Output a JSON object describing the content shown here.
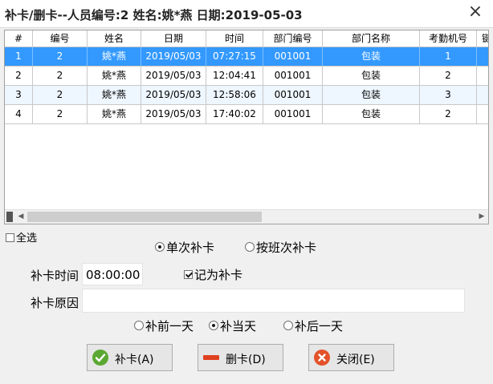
{
  "window": {
    "title": "补卡/删卡--人员编号:2 姓名:姚*燕 日期:2019-05-03",
    "close_glyph": "×"
  },
  "table": {
    "columns": [
      "#",
      "编号",
      "姓名",
      "日期",
      "时间",
      "部门编号",
      "部门名称",
      "考勤机号",
      "键"
    ],
    "rows": [
      [
        "1",
        "2",
        "姚*燕",
        "2019/05/03",
        "07:27:15",
        "001001",
        "包装",
        "1"
      ],
      [
        "2",
        "2",
        "姚*燕",
        "2019/05/03",
        "12:04:41",
        "001001",
        "包装",
        "2"
      ],
      [
        "3",
        "2",
        "姚*燕",
        "2019/05/03",
        "12:58:06",
        "001001",
        "包装",
        "3"
      ],
      [
        "4",
        "2",
        "姚*燕",
        "2019/05/03",
        "17:40:02",
        "001001",
        "包装",
        "2"
      ]
    ],
    "selected_row": 0
  },
  "select_all": {
    "label": "全选",
    "checked": false
  },
  "mode": {
    "single": {
      "label": "单次补卡",
      "checked": true
    },
    "by_shift": {
      "label": "按班次补卡",
      "checked": false
    }
  },
  "form": {
    "time_label": "补卡时间",
    "time_value": "08:00:00",
    "record_as": {
      "label": "记为补卡",
      "checked": true
    },
    "reason_label": "补卡原因",
    "reason_value": ""
  },
  "day": {
    "prev": {
      "label": "补前一天",
      "checked": false
    },
    "current": {
      "label": "补当天",
      "checked": true
    },
    "next": {
      "label": "补后一天",
      "checked": false
    }
  },
  "buttons": {
    "add": {
      "label": "补卡(A)",
      "icon": "green-check-icon",
      "color": "#5aa832"
    },
    "delete": {
      "label": "删卡(D)",
      "icon": "red-minus-icon",
      "color": "#e0401f"
    },
    "close": {
      "label": "关闭(E)",
      "icon": "red-x-icon",
      "color": "#e3522a"
    }
  },
  "colors": {
    "selection": "#3399ff",
    "alt_row": "#eef6ff"
  }
}
